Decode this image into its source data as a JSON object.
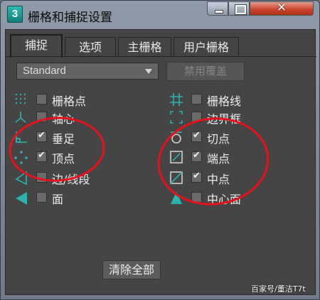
{
  "window": {
    "title": "栅格和捕捉设置",
    "app_icon_text": "3",
    "controls": {
      "close": "✕"
    }
  },
  "tabs": [
    {
      "label": "捕捉",
      "active": true
    },
    {
      "label": "选项",
      "active": false
    },
    {
      "label": "主栅格",
      "active": false
    },
    {
      "label": "用户栅格",
      "active": false
    }
  ],
  "snap_type": {
    "selected": "Standard"
  },
  "override_button": "禁用覆盖",
  "left_options": [
    {
      "label": "栅格点",
      "checked": false,
      "icon": "grid-points-icon"
    },
    {
      "label": "轴心",
      "checked": false,
      "icon": "pivot-icon"
    },
    {
      "label": "垂足",
      "checked": true,
      "icon": "perpendicular-icon"
    },
    {
      "label": "顶点",
      "checked": true,
      "icon": "vertex-icon"
    },
    {
      "label": "边/线段",
      "checked": false,
      "icon": "edge-segment-icon"
    },
    {
      "label": "面",
      "checked": false,
      "icon": "face-icon"
    }
  ],
  "right_options": [
    {
      "label": "栅格线",
      "checked": false,
      "icon": "grid-lines-icon"
    },
    {
      "label": "边界框",
      "checked": false,
      "icon": "bounding-box-icon"
    },
    {
      "label": "切点",
      "checked": true,
      "icon": "tangent-icon"
    },
    {
      "label": "端点",
      "checked": true,
      "icon": "endpoint-icon"
    },
    {
      "label": "中点",
      "checked": true,
      "icon": "midpoint-icon"
    },
    {
      "label": "中心面",
      "checked": false,
      "icon": "center-face-icon"
    }
  ],
  "clear_button": "清除全部",
  "watermark": "百家号/董洁T7t",
  "colors": {
    "annotation": "#e8121c",
    "accent": "#2ab3b0"
  }
}
